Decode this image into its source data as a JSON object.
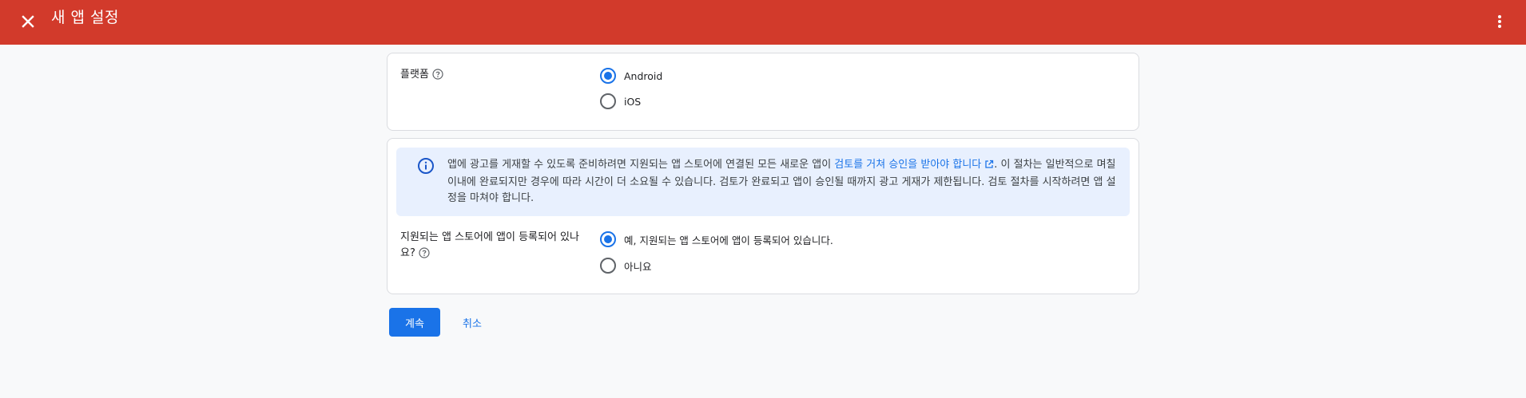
{
  "header": {
    "title": "새 앱 설정",
    "close_icon": "close-icon",
    "more_icon": "more-vert-icon",
    "bg_color": "#d23a2b"
  },
  "platform": {
    "label": "플랫폼",
    "options": [
      {
        "label": "Android",
        "selected": true
      },
      {
        "label": "iOS",
        "selected": false
      }
    ]
  },
  "notice": {
    "text_before": "앱에 광고를 게재할 수 있도록 준비하려면 지원되는 앱 스토어에 연결된 모든 새로운 앱이 ",
    "link_text": "검토를 거쳐 승인을 받아야 합니다",
    "text_after": ". 이 절차는 일반적으로 며칠 이내에 완료되지만 경우에 따라 시간이 더 소요될 수 있습니다. 검토가 완료되고 앱이 승인될 때까지 광고 게재가 제한됩니다. 검토 절차를 시작하려면 앱 설정을 마쳐야 합니다."
  },
  "store_listing": {
    "label": "지원되는 앱 스토어에 앱이 등록되어 있나요?",
    "options": [
      {
        "label": "예, 지원되는 앱 스토어에 앱이 등록되어 있습니다.",
        "selected": true
      },
      {
        "label": "아니요",
        "selected": false
      }
    ]
  },
  "actions": {
    "continue_label": "계속",
    "cancel_label": "취소"
  },
  "colors": {
    "accent": "#1a73e8",
    "info_bg": "#e8f0fe"
  }
}
